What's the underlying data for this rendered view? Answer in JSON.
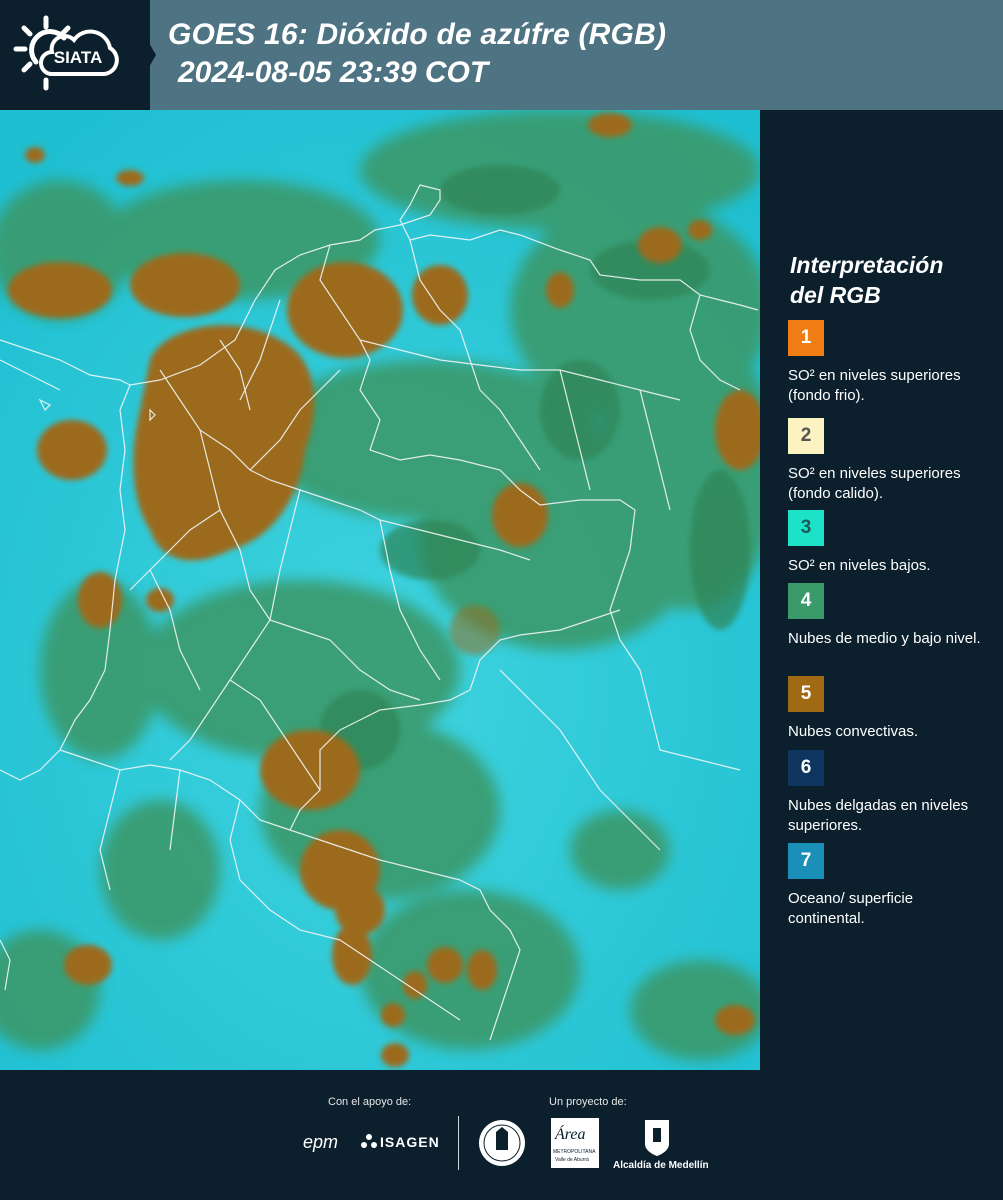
{
  "header": {
    "logo_text": "SIATA",
    "title_line1": "GOES 16: Dióxido de azúfre (RGB)",
    "title_line2": "2024-08-05 23:39 COT"
  },
  "legend": {
    "title_line1": "Interpretación",
    "title_line2": "del RGB",
    "items": [
      {
        "num": "1",
        "color": "#f07d14",
        "num_color": "#ffffff",
        "text": "SO² en niveles superiores (fondo frio)."
      },
      {
        "num": "2",
        "color": "#fdf3c2",
        "num_color": "#555555",
        "text": "SO² en niveles superiores (fondo calido)."
      },
      {
        "num": "3",
        "color": "#1de2c8",
        "num_color": "#1a5a55",
        "text": "SO² en niveles bajos."
      },
      {
        "num": "4",
        "color": "#3a9a6a",
        "num_color": "#ffffff",
        "text": "Nubes de medio y bajo nivel."
      },
      {
        "num": "5",
        "color": "#a06a14",
        "num_color": "#ffffff",
        "text": "Nubes convectivas."
      },
      {
        "num": "6",
        "color": "#0e3560",
        "num_color": "#ffffff",
        "text": "Nubes delgadas en niveles superiores."
      },
      {
        "num": "7",
        "color": "#1a8fb8",
        "num_color": "#ffffff",
        "text": "Oceano/ superficie continental."
      }
    ]
  },
  "footer": {
    "support_label": "Con el apoyo de:",
    "project_label": "Un proyecto de:",
    "epm": "epm",
    "isagen": "ISAGEN",
    "area_name": "Área",
    "area_sub1": "METROPOLITANA",
    "area_sub2": "Valle de Aburrá",
    "alcaldia": "Alcaldía de Medellín"
  }
}
